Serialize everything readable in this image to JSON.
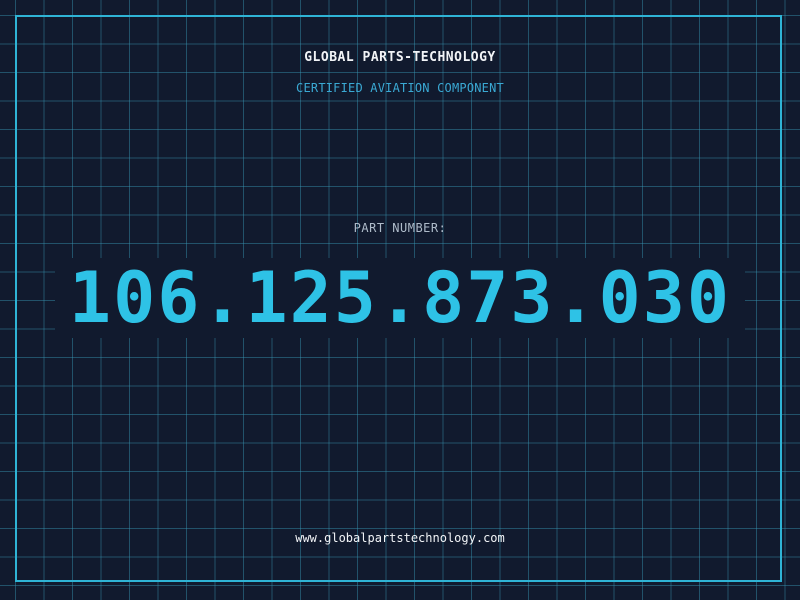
{
  "header": {
    "company": "GLOBAL PARTS-TECHNOLOGY",
    "tagline": "CERTIFIED AVIATION COMPONENT"
  },
  "part": {
    "label": "PART NUMBER:",
    "number": "106.125.873.030"
  },
  "footer": {
    "website": "www.globalpartstechnology.com"
  },
  "colors": {
    "background": "#111a2e",
    "grid": "#3896b4",
    "frame": "#2fb4d6",
    "accent": "#2ec2e6",
    "label": "#aebbc9",
    "text": "#f2f4f7"
  }
}
